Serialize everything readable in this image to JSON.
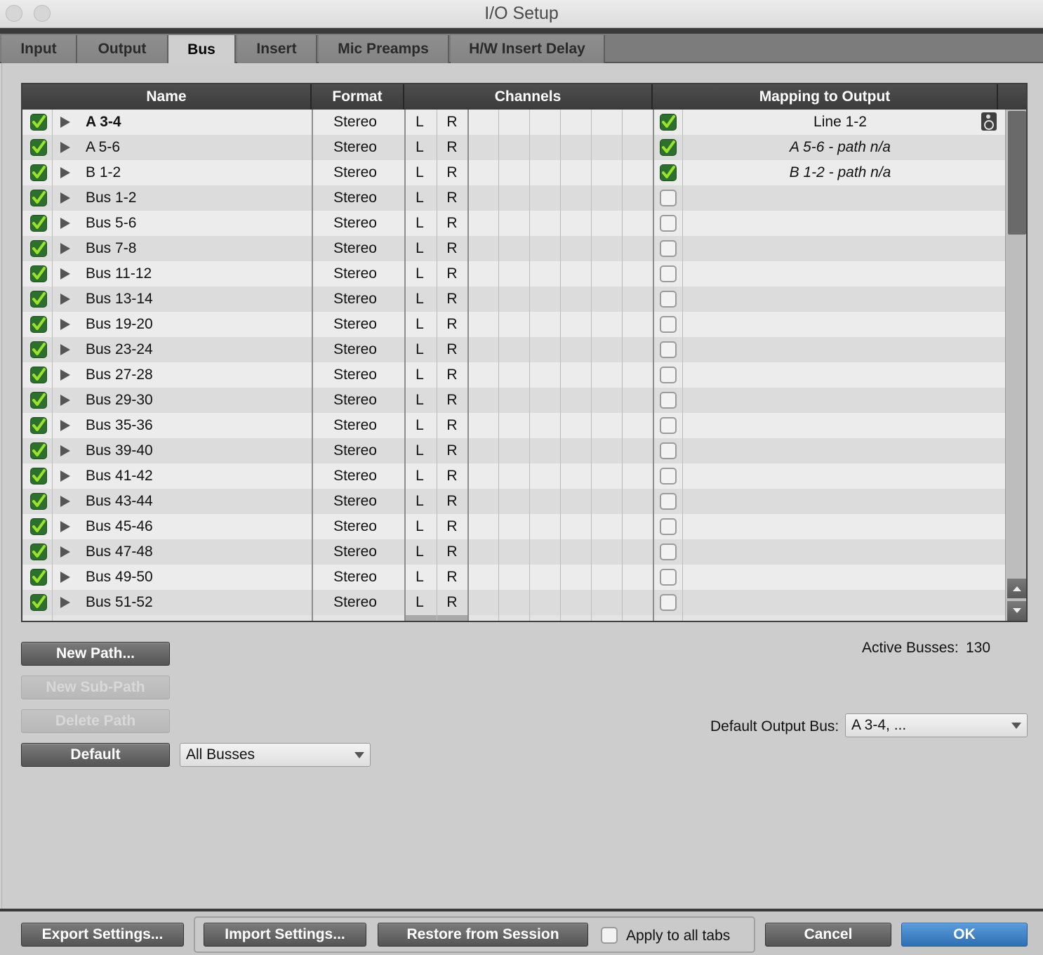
{
  "window": {
    "title": "I/O Setup"
  },
  "tabs": [
    {
      "label": "Input"
    },
    {
      "label": "Output"
    },
    {
      "label": "Bus"
    },
    {
      "label": "Insert"
    },
    {
      "label": "Mic Preamps"
    },
    {
      "label": "H/W Insert Delay"
    }
  ],
  "active_tab": "Bus",
  "table": {
    "headers": {
      "name": "Name",
      "format": "Format",
      "channels": "Channels",
      "mapping": "Mapping to Output"
    },
    "rows": [
      {
        "name": "A 3-4",
        "format": "Stereo",
        "l": "L",
        "r": "R",
        "enabled": true,
        "mapped": true,
        "mapping": "Line 1-2",
        "bold": true
      },
      {
        "name": "A 5-6",
        "format": "Stereo",
        "l": "L",
        "r": "R",
        "enabled": true,
        "mapped": true,
        "mapping": "A 5-6 - path n/a",
        "italic": true
      },
      {
        "name": "B 1-2",
        "format": "Stereo",
        "l": "L",
        "r": "R",
        "enabled": true,
        "mapped": true,
        "mapping": "B 1-2 - path n/a",
        "italic": true
      },
      {
        "name": "Bus 1-2",
        "format": "Stereo",
        "l": "L",
        "r": "R",
        "enabled": true,
        "mapped": false,
        "mapping": ""
      },
      {
        "name": "Bus 5-6",
        "format": "Stereo",
        "l": "L",
        "r": "R",
        "enabled": true,
        "mapped": false,
        "mapping": ""
      },
      {
        "name": "Bus 7-8",
        "format": "Stereo",
        "l": "L",
        "r": "R",
        "enabled": true,
        "mapped": false,
        "mapping": ""
      },
      {
        "name": "Bus 11-12",
        "format": "Stereo",
        "l": "L",
        "r": "R",
        "enabled": true,
        "mapped": false,
        "mapping": ""
      },
      {
        "name": "Bus 13-14",
        "format": "Stereo",
        "l": "L",
        "r": "R",
        "enabled": true,
        "mapped": false,
        "mapping": ""
      },
      {
        "name": "Bus 19-20",
        "format": "Stereo",
        "l": "L",
        "r": "R",
        "enabled": true,
        "mapped": false,
        "mapping": ""
      },
      {
        "name": "Bus 23-24",
        "format": "Stereo",
        "l": "L",
        "r": "R",
        "enabled": true,
        "mapped": false,
        "mapping": ""
      },
      {
        "name": "Bus 27-28",
        "format": "Stereo",
        "l": "L",
        "r": "R",
        "enabled": true,
        "mapped": false,
        "mapping": ""
      },
      {
        "name": "Bus 29-30",
        "format": "Stereo",
        "l": "L",
        "r": "R",
        "enabled": true,
        "mapped": false,
        "mapping": ""
      },
      {
        "name": "Bus 35-36",
        "format": "Stereo",
        "l": "L",
        "r": "R",
        "enabled": true,
        "mapped": false,
        "mapping": ""
      },
      {
        "name": "Bus 39-40",
        "format": "Stereo",
        "l": "L",
        "r": "R",
        "enabled": true,
        "mapped": false,
        "mapping": ""
      },
      {
        "name": "Bus 41-42",
        "format": "Stereo",
        "l": "L",
        "r": "R",
        "enabled": true,
        "mapped": false,
        "mapping": ""
      },
      {
        "name": "Bus 43-44",
        "format": "Stereo",
        "l": "L",
        "r": "R",
        "enabled": true,
        "mapped": false,
        "mapping": ""
      },
      {
        "name": "Bus 45-46",
        "format": "Stereo",
        "l": "L",
        "r": "R",
        "enabled": true,
        "mapped": false,
        "mapping": ""
      },
      {
        "name": "Bus 47-48",
        "format": "Stereo",
        "l": "L",
        "r": "R",
        "enabled": true,
        "mapped": false,
        "mapping": ""
      },
      {
        "name": "Bus 49-50",
        "format": "Stereo",
        "l": "L",
        "r": "R",
        "enabled": true,
        "mapped": false,
        "mapping": ""
      },
      {
        "name": "Bus 51-52",
        "format": "Stereo",
        "l": "L",
        "r": "R",
        "enabled": true,
        "mapped": false,
        "mapping": ""
      }
    ]
  },
  "buttons": {
    "new_path": "New Path...",
    "new_sub_path": "New Sub-Path",
    "delete_path": "Delete Path",
    "default": "Default",
    "export": "Export Settings...",
    "import": "Import Settings...",
    "restore": "Restore from Session",
    "cancel": "Cancel",
    "ok": "OK"
  },
  "filter_select": {
    "value": "All Busses"
  },
  "active_busses": {
    "label": "Active Busses:",
    "value": "130"
  },
  "default_output": {
    "label": "Default Output Bus:",
    "value": "A 3-4, ..."
  },
  "apply_all": {
    "label": "Apply to all tabs",
    "checked": false
  },
  "icons": {
    "enabled_check": "checkmark-icon",
    "expand": "triangle-right-icon",
    "speaker": "speaker-icon",
    "scroll_up": "arrow-up-icon",
    "scroll_down": "arrow-down-icon"
  },
  "colors": {
    "check_green": "#2d6f2d",
    "check_mark": "#9be22e",
    "ok_blue": "#3a82c9"
  }
}
